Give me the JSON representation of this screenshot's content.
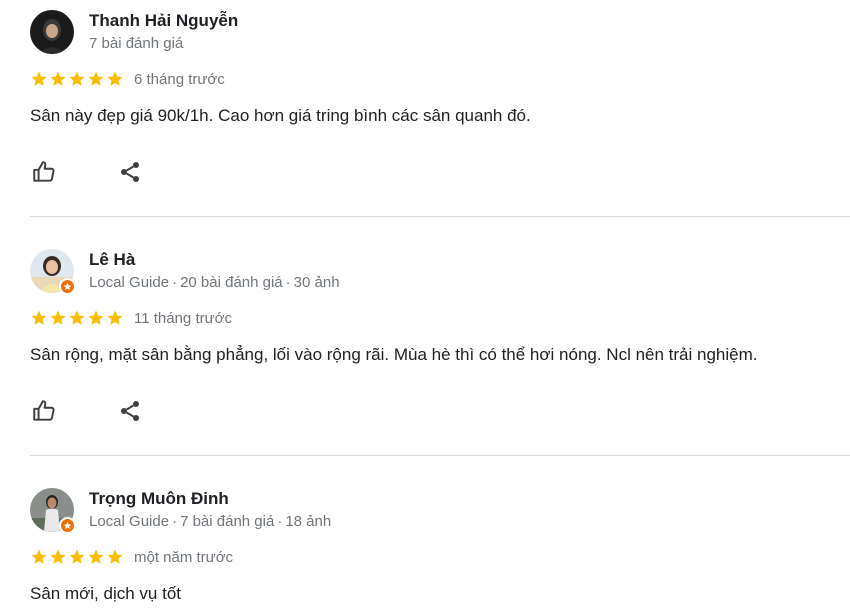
{
  "colors": {
    "star": "#fbbc04",
    "muted": "#70757a",
    "text": "#202124",
    "divider": "#dadce0",
    "guide_badge": "#e8710a"
  },
  "icons": {
    "star": "star-icon",
    "like": "thumbs-up-icon",
    "share": "share-icon",
    "guide": "local-guide-badge-icon"
  },
  "reviews": [
    {
      "author": "Thanh Hải Nguyễn",
      "meta": "7 bài đánh giá",
      "stars": 5,
      "age": "6 tháng trước",
      "text": "Sân này đẹp giá 90k/1h. Cao hơn giá tring bình các sân quanh đó."
    },
    {
      "author": "Lê Hà",
      "guide": "Local Guide",
      "meta_reviews": "20 bài đánh giá",
      "meta_photos": "30 ảnh",
      "stars": 5,
      "age": "11 tháng trước",
      "text": "Sân rộng, mặt sân bằng phẳng, lối vào rộng rãi. Mùa hè thì có thể hơi nóng. Ncl nên trải nghiệm."
    },
    {
      "author": "Trọng Muôn Đinh",
      "guide": "Local Guide",
      "meta_reviews": "7 bài đánh giá",
      "meta_photos": "18 ảnh",
      "stars": 5,
      "age": "một năm trước",
      "text": "Sân mới, dịch vụ tốt"
    }
  ]
}
